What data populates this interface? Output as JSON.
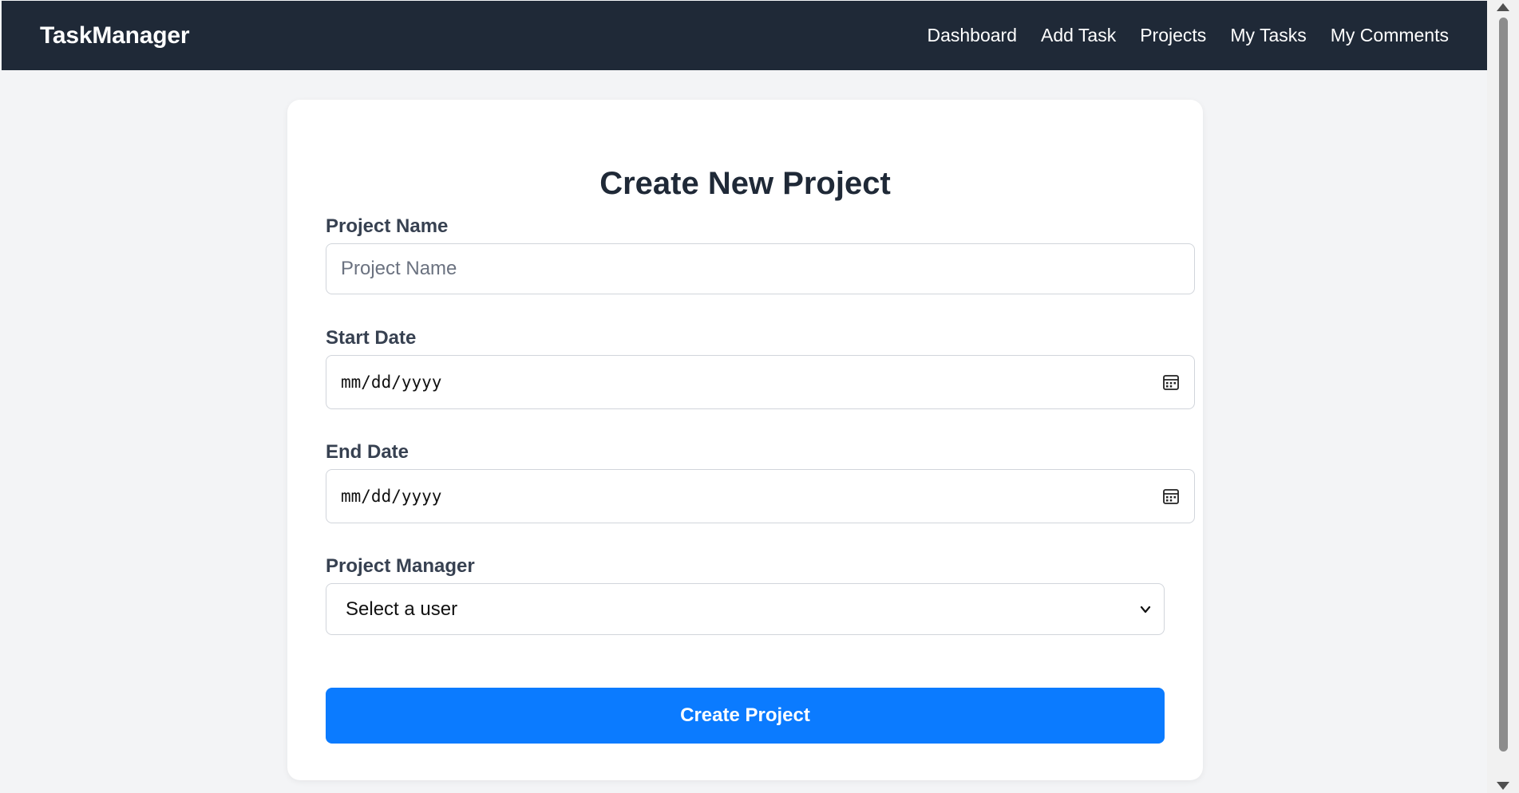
{
  "navbar": {
    "brand": "TaskManager",
    "links": [
      "Dashboard",
      "Add Task",
      "Projects",
      "My Tasks",
      "My Comments"
    ]
  },
  "form": {
    "title": "Create New Project",
    "project_name": {
      "label": "Project Name",
      "placeholder": "Project Name",
      "value": ""
    },
    "start_date": {
      "label": "Start Date",
      "value": "mm/dd/yyyy"
    },
    "end_date": {
      "label": "End Date",
      "value": "mm/dd/yyyy"
    },
    "project_manager": {
      "label": "Project Manager",
      "selected": "Select a user"
    },
    "submit_label": "Create Project"
  },
  "colors": {
    "navbar_bg": "#1f2937",
    "page_bg": "#f3f4f6",
    "primary_button": "#0b7bff"
  },
  "icons": {
    "date_picker": "calendar-icon",
    "select_dropdown": "chevron-down-icon"
  }
}
